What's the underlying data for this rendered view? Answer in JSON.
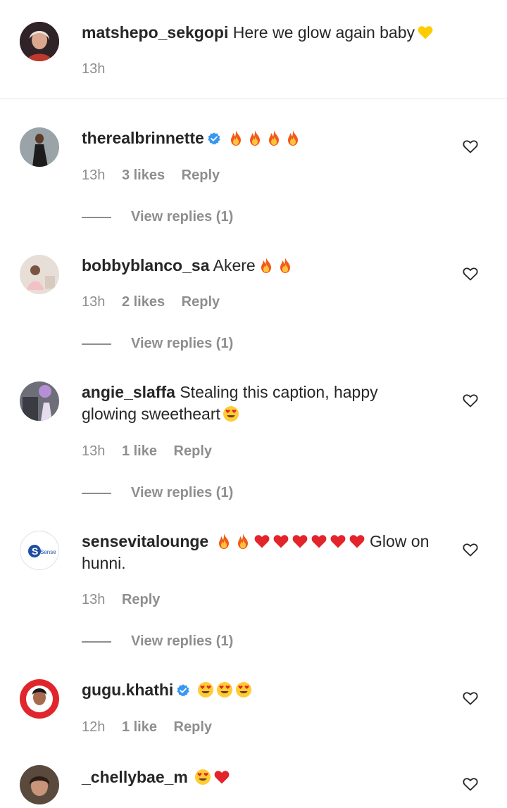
{
  "caption": {
    "username": "matshepo_sekgopi",
    "text": "Here we glow again baby",
    "time": "13h"
  },
  "comments": [
    {
      "username": "therealbrinnette",
      "text": "",
      "time": "13h",
      "likes": "3 likes",
      "reply": "Reply",
      "view_replies": "View replies (1)"
    },
    {
      "username": "bobbyblanco_sa",
      "text": "Akere",
      "time": "13h",
      "likes": "2 likes",
      "reply": "Reply",
      "view_replies": "View replies (1)"
    },
    {
      "username": "angie_slaffa",
      "text": "Stealing this caption, happy glowing sweetheart",
      "time": "13h",
      "likes": "1 like",
      "reply": "Reply",
      "view_replies": "View replies (1)"
    },
    {
      "username": "sensevitalounge",
      "text_after": "Glow on hunni.",
      "time": "13h",
      "reply": "Reply",
      "view_replies": "View replies (1)",
      "avatar_text": "Sense"
    },
    {
      "username": "gugu.khathi",
      "text": "",
      "time": "12h",
      "likes": "1 like",
      "reply": "Reply"
    },
    {
      "username": "_chellybae_m",
      "text": ""
    }
  ],
  "icons": {
    "like": "heart-outline-icon",
    "verified": "verified-badge-icon"
  },
  "colors": {
    "verified": "#3897f0",
    "meta": "#8e8e8e",
    "text": "#262626"
  }
}
